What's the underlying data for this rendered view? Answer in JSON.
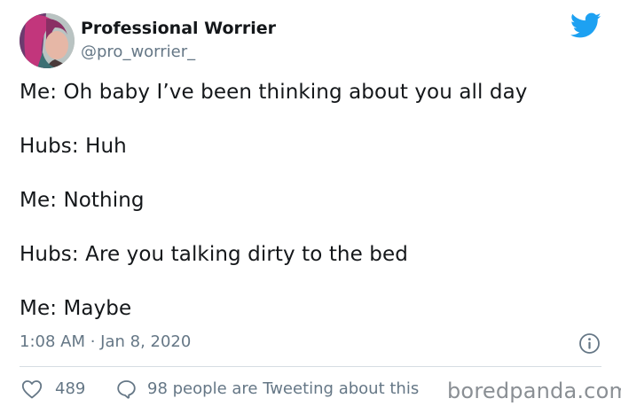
{
  "author": {
    "display_name": "Professional Worrier",
    "handle": "@pro_worrier_",
    "avatar_icon": "profile-photo"
  },
  "brand": {
    "logo_icon": "twitter-bird-icon",
    "color": "#1da1f2"
  },
  "tweet": {
    "lines": [
      "Me: Oh baby I’ve been thinking about you all day",
      "Hubs: Huh",
      "Me: Nothing",
      "Hubs: Are you talking dirty to the bed",
      "Me: Maybe"
    ],
    "timestamp": "1:08 AM · Jan 8, 2020"
  },
  "engagement": {
    "likes": "489",
    "tweeting_text": "98 people are Tweeting about this"
  },
  "watermark": "boredpanda.com",
  "colors": {
    "text": "#14171a",
    "muted": "#657786",
    "divider": "#d6dde3",
    "watermark": "#8a8f94"
  }
}
